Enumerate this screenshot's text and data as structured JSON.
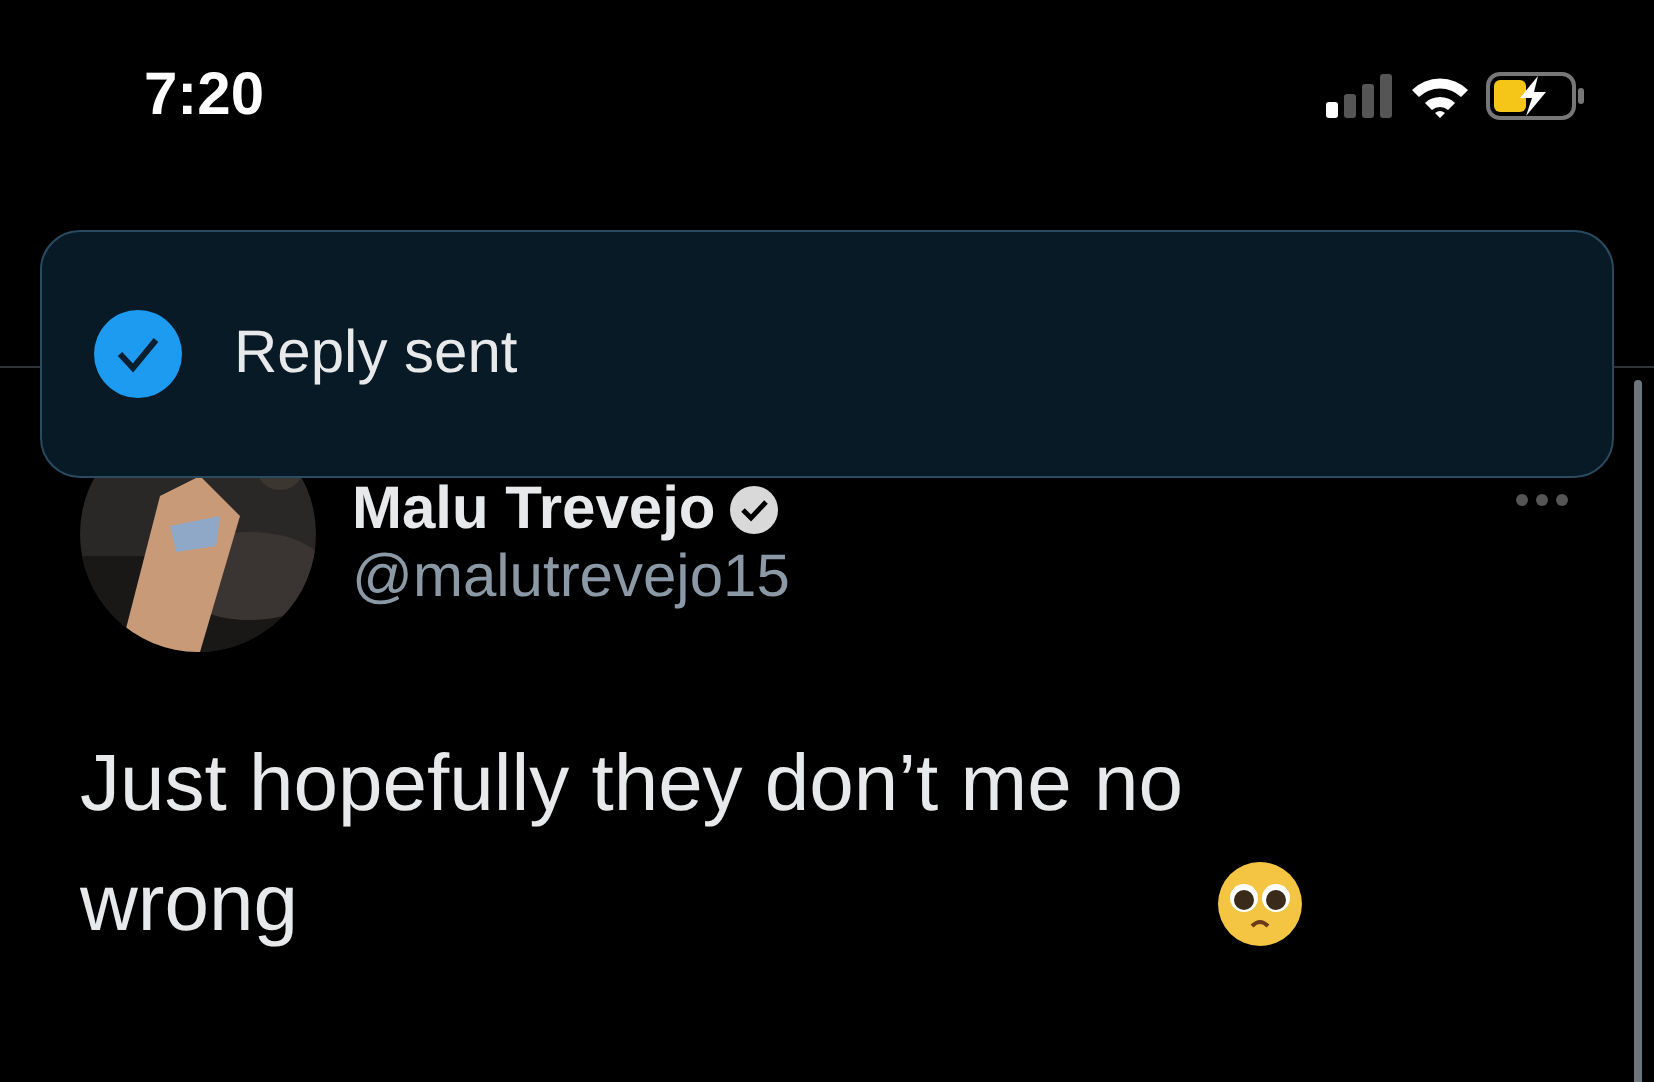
{
  "status_bar": {
    "time": "7:20"
  },
  "toast": {
    "text": "Reply sent"
  },
  "tweet": {
    "name": "Malu Trevejo",
    "verified": true,
    "handle": "@malutrevejo15",
    "text": "Just hopefully they don’t me no wrong"
  }
}
